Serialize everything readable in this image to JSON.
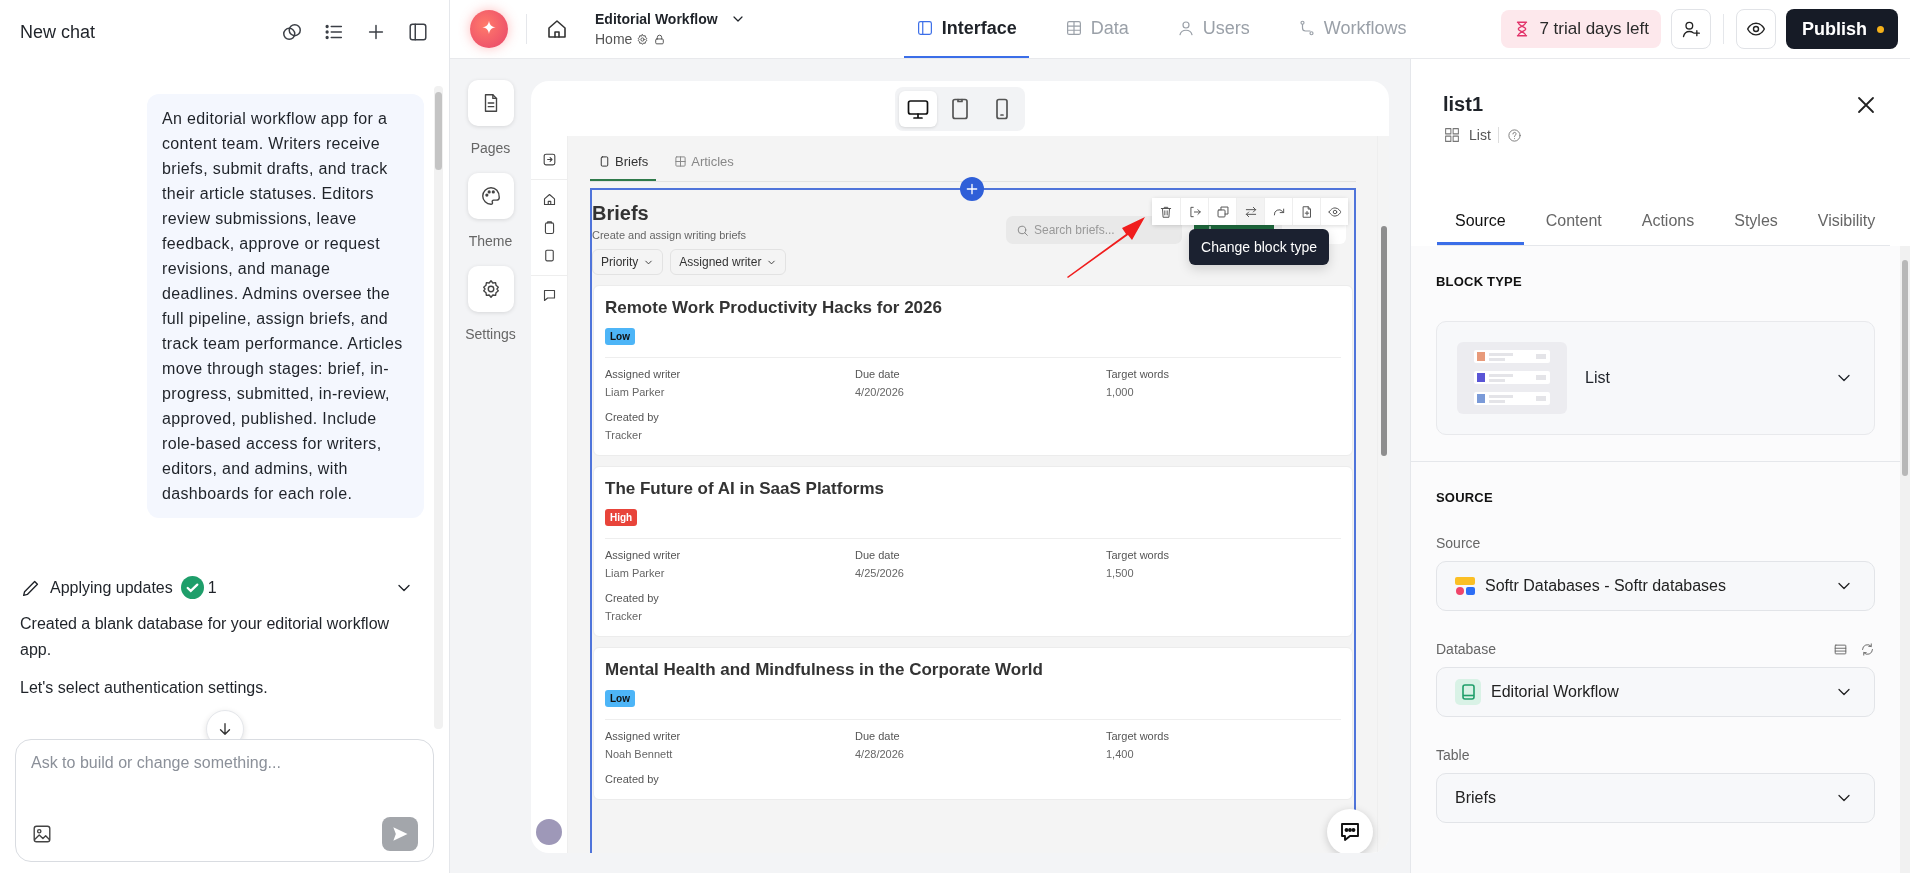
{
  "chat": {
    "title": "New chat",
    "message": "An editorial workflow app for a content team. Writers receive briefs, submit drafts, and track their article statuses. Editors review submissions, leave feedback, approve or request revisions, and manage deadlines. Admins oversee the full pipeline, assign briefs, and track team performance. Articles move through stages: brief, in-progress, submitted, in-review, approved, published. Include role-based access for writers, editors, and admins, with dashboards for each role.",
    "update": {
      "title": "Applying updates",
      "count": "1",
      "done": true,
      "expanded": false
    },
    "replies": [
      "Created a blank database for your editorial workflow app.",
      "Let's select authentication settings."
    ],
    "input": {
      "placeholder": "Ask to build or change something..."
    }
  },
  "topbar": {
    "app_name": "Editorial Workflow",
    "page": "Home",
    "tabs": [
      {
        "label": "Interface",
        "kind": "interface",
        "selected": true
      },
      {
        "label": "Data",
        "kind": "data",
        "selected": false
      },
      {
        "label": "Users",
        "kind": "users",
        "selected": false
      },
      {
        "label": "Workflows",
        "kind": "workflows",
        "selected": false
      }
    ],
    "trial": "7 trial days left",
    "publish": "Publish",
    "unpublished_changes": true
  },
  "rail": [
    {
      "label": "Pages",
      "kind": "pages"
    },
    {
      "label": "Theme",
      "kind": "theme"
    },
    {
      "label": "Settings",
      "kind": "settings"
    }
  ],
  "devices": [
    {
      "kind": "desktop",
      "selected": true
    },
    {
      "kind": "tablet",
      "selected": false
    },
    {
      "kind": "mobile",
      "selected": false
    }
  ],
  "page_tabs": [
    {
      "label": "Briefs",
      "kind": "page",
      "selected": true
    },
    {
      "label": "Articles",
      "kind": "table",
      "selected": false
    }
  ],
  "block": {
    "title": "Briefs",
    "subtitle": "Create and assign writing briefs",
    "search_placeholder": "Search briefs...",
    "filters": [
      "Priority",
      "Assigned writer"
    ],
    "actions": [
      {
        "kind": "primary"
      },
      {
        "kind": "ai"
      }
    ],
    "toolbar": [
      {
        "kind": "delete",
        "selected": false
      },
      {
        "kind": "move",
        "selected": false
      },
      {
        "kind": "duplicate",
        "selected": false
      },
      {
        "kind": "swap",
        "selected": true
      },
      {
        "kind": "redo",
        "selected": false
      },
      {
        "kind": "add-page",
        "selected": false
      },
      {
        "kind": "visibility",
        "selected": false
      }
    ],
    "tooltip": "Change block type",
    "annotation": {
      "kind": "arrow"
    },
    "items": [
      {
        "title": "Remote Work Productivity Hacks for 2026",
        "priority": {
          "label": "Low",
          "kind": "low"
        },
        "fields": [
          {
            "label": "Assigned writer",
            "value": "Liam Parker"
          },
          {
            "label": "Due date",
            "value": "4/20/2026"
          },
          {
            "label": "Target words",
            "value": "1,000"
          },
          {
            "label": "Created by",
            "value": "Tracker"
          }
        ]
      },
      {
        "title": "The Future of AI in SaaS Platforms",
        "priority": {
          "label": "High",
          "kind": "high"
        },
        "fields": [
          {
            "label": "Assigned writer",
            "value": "Liam Parker"
          },
          {
            "label": "Due date",
            "value": "4/25/2026"
          },
          {
            "label": "Target words",
            "value": "1,500"
          },
          {
            "label": "Created by",
            "value": "Tracker"
          }
        ]
      },
      {
        "title": "Mental Health and Mindfulness in the Corporate World",
        "priority": {
          "label": "Low",
          "kind": "low"
        },
        "fields": [
          {
            "label": "Assigned writer",
            "value": "Noah Bennett"
          },
          {
            "label": "Due date",
            "value": "4/28/2026"
          },
          {
            "label": "Target words",
            "value": "1,400"
          },
          {
            "label": "Created by"
          }
        ]
      }
    ]
  },
  "panel": {
    "title": "list1",
    "type": "List",
    "tabs": [
      {
        "label": "Source",
        "selected": true
      },
      {
        "label": "Content",
        "selected": false
      },
      {
        "label": "Actions",
        "selected": false
      },
      {
        "label": "Styles",
        "selected": false
      },
      {
        "label": "Visibility",
        "selected": false
      }
    ],
    "block_type": {
      "heading": "BLOCK TYPE",
      "value": "List"
    },
    "source": {
      "heading": "SOURCE",
      "fields": [
        {
          "label": "Source",
          "value": "Softr Databases - Softr databases",
          "kind": "source"
        },
        {
          "label": "Database",
          "value": "Editorial Workflow",
          "kind": "database"
        },
        {
          "label": "Table",
          "value": "Briefs",
          "kind": "plain"
        }
      ]
    }
  }
}
